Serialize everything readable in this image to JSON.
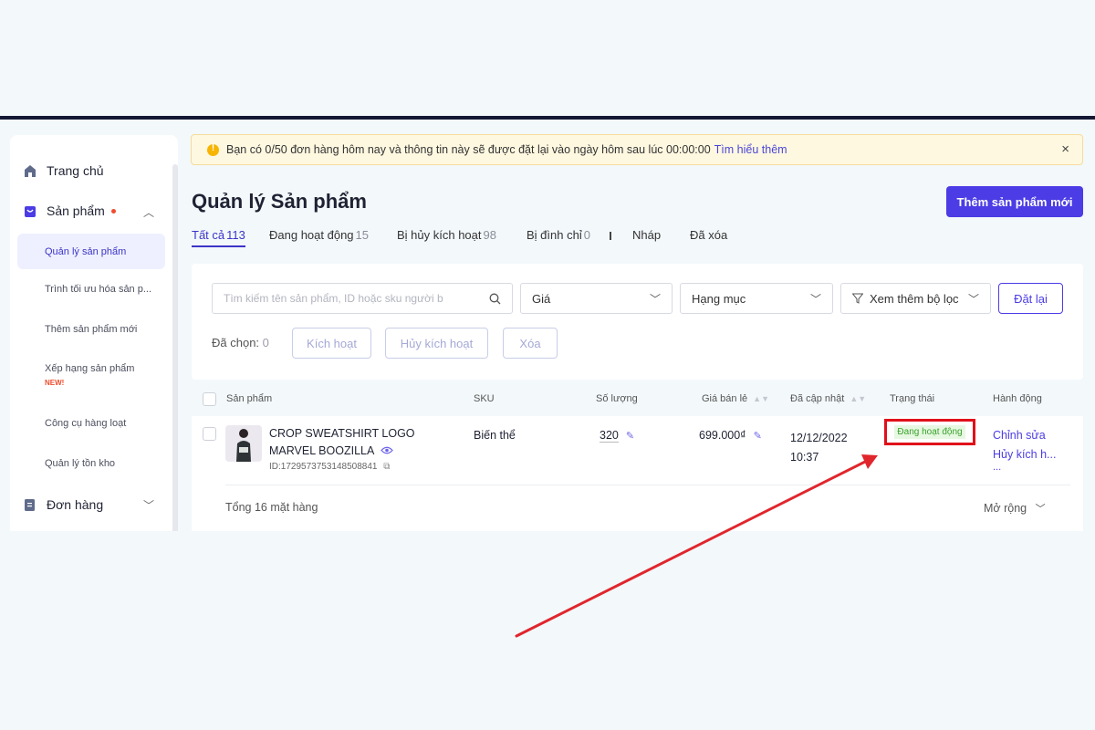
{
  "sidebar": {
    "home": "Trang chủ",
    "products": "Sản phẩm",
    "product_items": [
      "Quản lý sản phẩm",
      "Trình tối ưu hóa sản p...",
      "Thêm sản phẩm mới",
      "Xếp hạng sản phẩm",
      "Công cụ hàng loạt",
      "Quản lý tồn kho"
    ],
    "new_tag": "NEW!",
    "orders": "Đơn hàng"
  },
  "alert": {
    "text": "Bạn có 0/50 đơn hàng hôm nay và thông tin này sẽ được đặt lại vào ngày hôm sau lúc 00:00:00",
    "link": "Tìm hiểu thêm",
    "close": "×"
  },
  "page": {
    "title": "Quản lý Sản phẩm",
    "add_button": "Thêm sản phẩm mới"
  },
  "tabs": [
    {
      "label": "Tất cả",
      "count": "113"
    },
    {
      "label": "Đang hoạt động",
      "count": "15"
    },
    {
      "label": "Bị hủy kích hoạt",
      "count": "98"
    },
    {
      "label": "Bị đình chỉ",
      "count": "0"
    },
    {
      "label": "Nháp",
      "count": ""
    },
    {
      "label": "Đã xóa",
      "count": ""
    }
  ],
  "filters": {
    "search_placeholder": "Tìm kiếm tên sản phẩm, ID hoặc sku người b",
    "price": "Giá",
    "category": "Hạng mục",
    "more_filters": "Xem thêm bộ lọc",
    "reset": "Đặt lại",
    "selected_label": "Đã chọn:",
    "selected_count": "0",
    "activate": "Kích hoạt",
    "deactivate": "Hủy kích hoạt",
    "delete": "Xóa"
  },
  "table": {
    "headers": [
      "Sản phẩm",
      "SKU",
      "Số lượng",
      "Giá bán lẻ",
      "Đã cập nhật",
      "Trạng thái",
      "Hành động"
    ],
    "row": {
      "name": "CROP SWEATSHIRT LOGO MARVEL BOOZILLA",
      "id": "ID:1729573753148508841",
      "sku": "Biến thể",
      "quantity": "320",
      "price": "699.000₫",
      "updated_date": "12/12/2022",
      "updated_time": "10:37",
      "status": "Đang hoạt động",
      "action_edit": "Chỉnh sửa",
      "action_deactivate": "Hủy kích h...",
      "action_more": "..."
    },
    "total": "Tổng 16 mặt hàng",
    "expand": "Mở rộng"
  },
  "colors": {
    "accent": "#4b3ce5",
    "highlight_box": "#e0101a",
    "annotation_arrow": "#e0262c",
    "status_green": "#37a229"
  }
}
